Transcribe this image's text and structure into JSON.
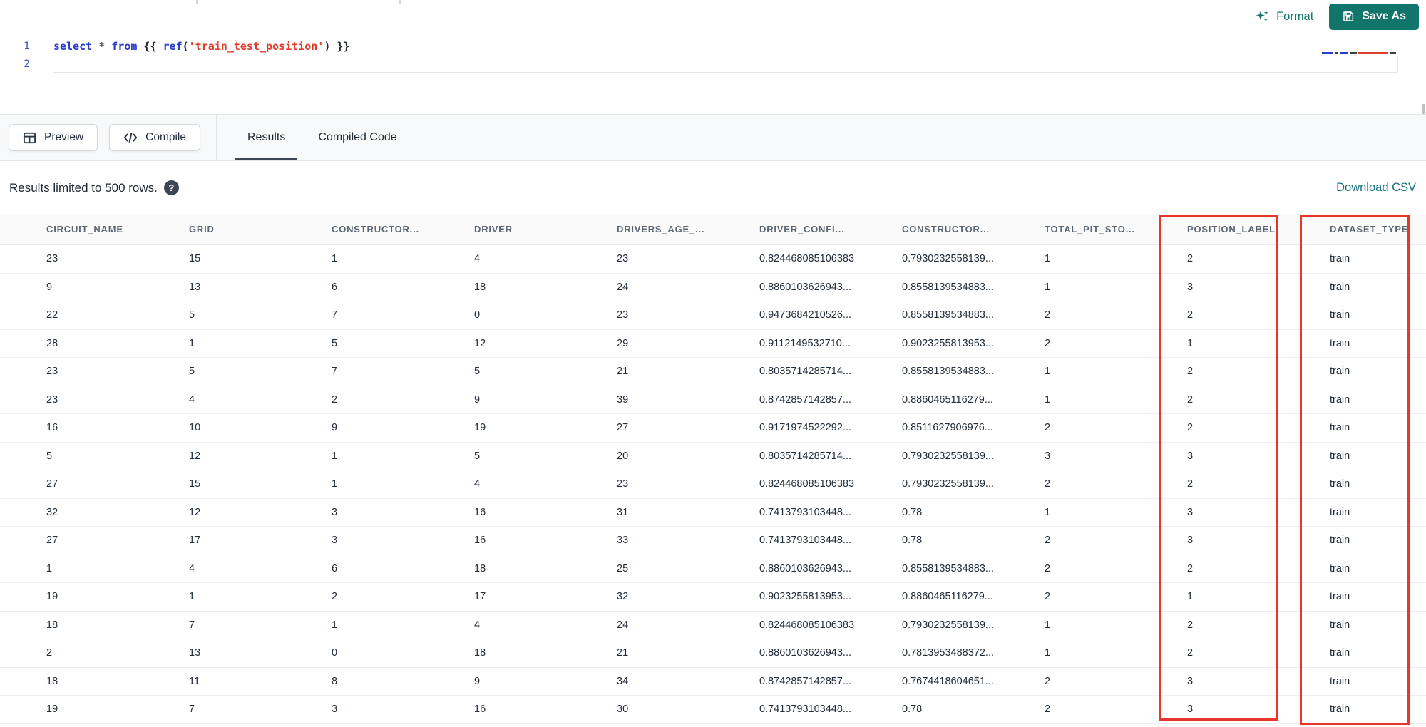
{
  "top_toolbar": {
    "format_label": "Format",
    "save_as_label": "Save As"
  },
  "editor": {
    "line_numbers": [
      "1",
      "2"
    ],
    "code_line_text": "select * from {{ ref('train_test_position') }}",
    "code_tokens": [
      {
        "text": "select",
        "type": "keyword"
      },
      {
        "text": " ",
        "type": "plain"
      },
      {
        "text": "*",
        "type": "operator"
      },
      {
        "text": " ",
        "type": "plain"
      },
      {
        "text": "from",
        "type": "keyword"
      },
      {
        "text": " {{ ",
        "type": "plain"
      },
      {
        "text": "ref",
        "type": "function"
      },
      {
        "text": "(",
        "type": "plain"
      },
      {
        "text": "'train_test_position'",
        "type": "string"
      },
      {
        "text": ")",
        "type": "plain"
      },
      {
        "text": " }}",
        "type": "plain"
      }
    ]
  },
  "action_bar": {
    "preview_label": "Preview",
    "compile_label": "Compile",
    "tabs": [
      {
        "label": "Results",
        "active": true
      },
      {
        "label": "Compiled Code",
        "active": false
      }
    ]
  },
  "results_bar": {
    "limit_text": "Results limited to 500 rows.",
    "help_glyph": "?",
    "download_label": "Download CSV"
  },
  "table": {
    "columns": [
      "CIRCUIT_NAME",
      "GRID",
      "CONSTRUCTOR...",
      "DRIVER",
      "DRIVERS_AGE_...",
      "DRIVER_CONFI...",
      "CONSTRUCTOR...",
      "TOTAL_PIT_STO...",
      "POSITION_LABEL",
      "DATASET_TYPE"
    ],
    "rows": [
      [
        "23",
        "15",
        "1",
        "4",
        "23",
        "0.824468085106383",
        "0.7930232558139...",
        "1",
        "2",
        "train"
      ],
      [
        "9",
        "13",
        "6",
        "18",
        "24",
        "0.8860103626943...",
        "0.8558139534883...",
        "1",
        "3",
        "train"
      ],
      [
        "22",
        "5",
        "7",
        "0",
        "23",
        "0.9473684210526...",
        "0.8558139534883...",
        "2",
        "2",
        "train"
      ],
      [
        "28",
        "1",
        "5",
        "12",
        "29",
        "0.9112149532710...",
        "0.9023255813953...",
        "2",
        "1",
        "train"
      ],
      [
        "23",
        "5",
        "7",
        "5",
        "21",
        "0.8035714285714...",
        "0.8558139534883...",
        "1",
        "2",
        "train"
      ],
      [
        "23",
        "4",
        "2",
        "9",
        "39",
        "0.8742857142857...",
        "0.8860465116279...",
        "1",
        "2",
        "train"
      ],
      [
        "16",
        "10",
        "9",
        "19",
        "27",
        "0.9171974522292...",
        "0.8511627906976...",
        "2",
        "2",
        "train"
      ],
      [
        "5",
        "12",
        "1",
        "5",
        "20",
        "0.8035714285714...",
        "0.7930232558139...",
        "3",
        "3",
        "train"
      ],
      [
        "27",
        "15",
        "1",
        "4",
        "23",
        "0.824468085106383",
        "0.7930232558139...",
        "2",
        "2",
        "train"
      ],
      [
        "32",
        "12",
        "3",
        "16",
        "31",
        "0.7413793103448...",
        "0.78",
        "1",
        "3",
        "train"
      ],
      [
        "27",
        "17",
        "3",
        "16",
        "33",
        "0.7413793103448...",
        "0.78",
        "2",
        "3",
        "train"
      ],
      [
        "1",
        "4",
        "6",
        "18",
        "25",
        "0.8860103626943...",
        "0.8558139534883...",
        "2",
        "2",
        "train"
      ],
      [
        "19",
        "1",
        "2",
        "17",
        "32",
        "0.9023255813953...",
        "0.8860465116279...",
        "2",
        "1",
        "train"
      ],
      [
        "18",
        "7",
        "1",
        "4",
        "24",
        "0.824468085106383",
        "0.7930232558139...",
        "1",
        "2",
        "train"
      ],
      [
        "2",
        "13",
        "0",
        "18",
        "21",
        "0.8860103626943...",
        "0.7813953488372...",
        "1",
        "2",
        "train"
      ],
      [
        "18",
        "11",
        "8",
        "9",
        "34",
        "0.8742857142857...",
        "0.7674418604651...",
        "2",
        "3",
        "train"
      ],
      [
        "19",
        "7",
        "3",
        "16",
        "30",
        "0.7413793103448...",
        "0.78",
        "2",
        "3",
        "train"
      ]
    ],
    "highlighted_columns": [
      "POSITION_LABEL",
      "DATASET_TYPE"
    ]
  },
  "colors": {
    "accent_teal": "#12756B",
    "link_teal": "#15707F",
    "highlight_red": "#E8362D",
    "keyword_blue": "#2B3ECC",
    "string_red": "#DE3E2B"
  }
}
